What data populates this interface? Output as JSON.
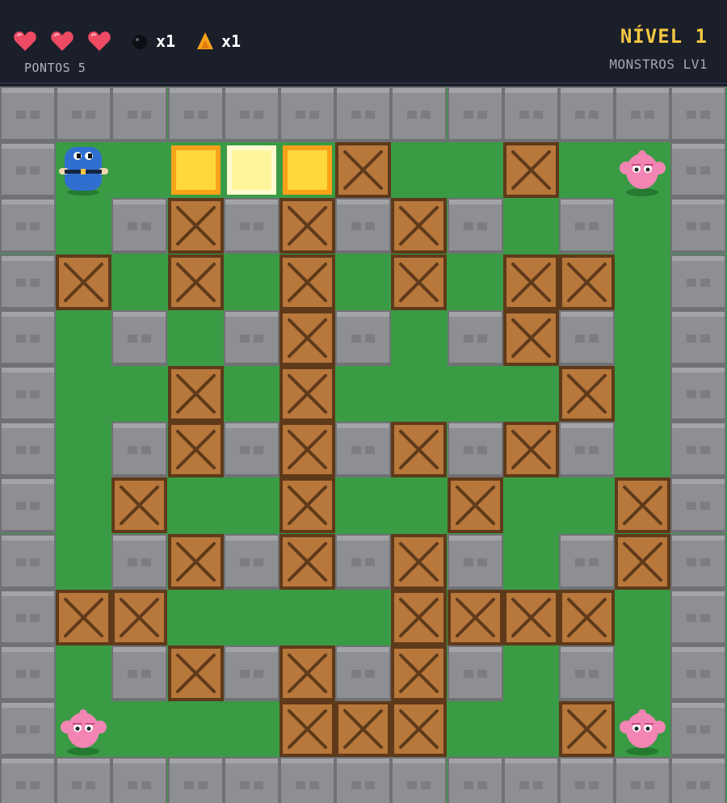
{
  "hud": {
    "lives": 3,
    "bombs_label": "x1",
    "fire_label": "x1",
    "score_label": "PONTOS 5",
    "level_label": "NÍVEL 1",
    "monsters_label": "MONSTROS LV1",
    "icons": [
      "heart-icon",
      "bomb-icon",
      "fire-icon"
    ]
  },
  "colors": {
    "hud_bg": "#1b1f2a",
    "heart": "#ee4a63",
    "level": "#f3c742",
    "grass": "#3a9b45",
    "grass_dark": "#2f8e3a",
    "wall": "#8d8f93",
    "crate": "#b8773b",
    "crate_dark": "#5e3a1a",
    "fire": "#f8a21a",
    "fire_core": "#ffd83b",
    "player": "#2f6fd0",
    "monster": "#f285b4"
  },
  "board": {
    "columns": 13,
    "rows": 13,
    "legend": {
      "W": "stone-wall",
      "C": "wooden-crate",
      "F": "explosion-flame",
      "E": "explosion-center",
      "P": "player",
      "M": "monster",
      ".": "grass"
    },
    "grid": [
      "WWWWWWWWWWWWW",
      "WP.FEFC..C.MW",
      "W.WCWCWCW.W.W",
      "WC.C.C.C.CC.W",
      "W.W.WCW.WCW.W",
      "W..C.C....C.W",
      "W.WCWCWCWCW.W",
      "W.C..C..C..CW",
      "W.WCWCWCW.WCW",
      "WCC....CCCC.W",
      "W.WCWCWCW.W.W",
      "WM...CCC..CMW",
      "WWWWWWWWWWWWW"
    ]
  }
}
